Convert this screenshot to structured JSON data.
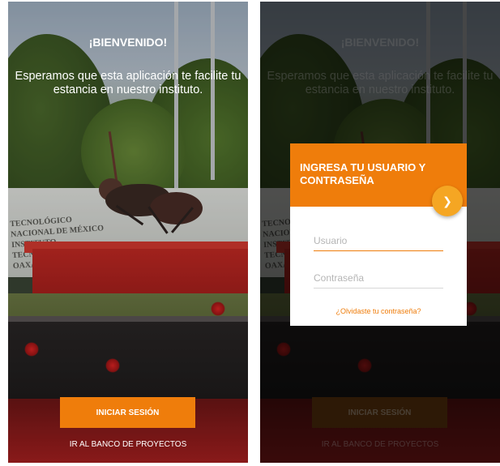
{
  "welcome": {
    "title": "¡BIENVENIDO!",
    "message": "Esperamos que esta aplicación te facilite tu estancia en nuestro instituto."
  },
  "actions": {
    "login_label": "INICIAR SESIÓN",
    "projects_label": "IR AL BANCO DE PROYECTOS"
  },
  "background": {
    "sign_line1": "TECNOLÓGICO NACIONAL DE MÉXICO",
    "sign_line2": "INSTITUTO TECNOLÓGICO DE OAXACA"
  },
  "login_dialog": {
    "title": "INGRESA TU USUARIO Y CONTRASEÑA",
    "user_placeholder": "Usuario",
    "password_placeholder": "Contraseña",
    "forgot_label": "¿Olvidaste tu contraseña?",
    "next_icon": "chevron-right-icon"
  },
  "colors": {
    "accent": "#ef7d0b",
    "fab": "#f5a623"
  }
}
